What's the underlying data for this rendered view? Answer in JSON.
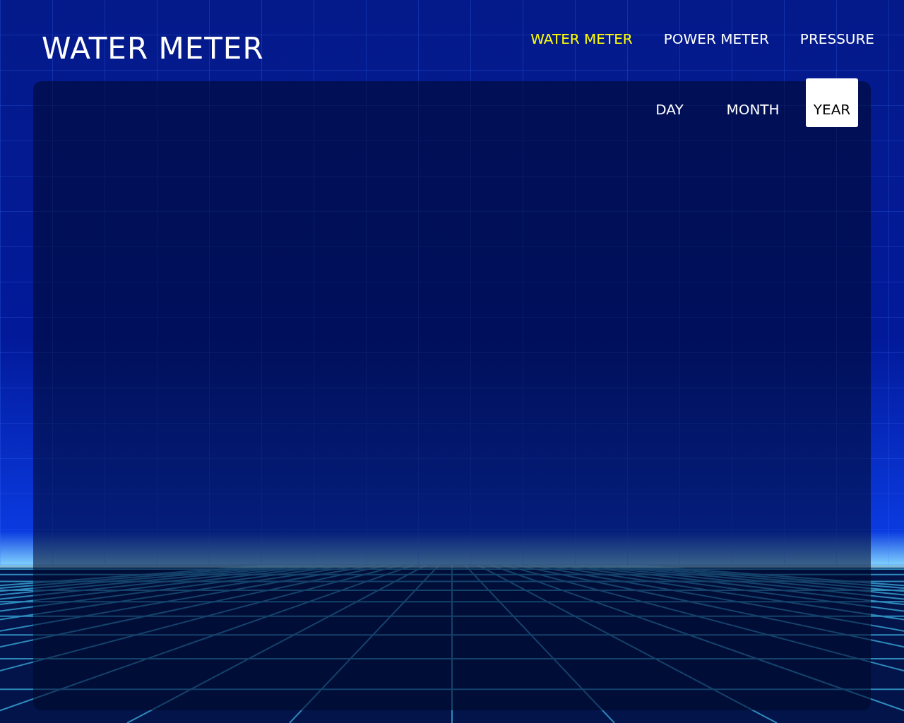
{
  "header": {
    "title": "WATER METER"
  },
  "nav": [
    {
      "label": "WATER METER",
      "selected": true
    },
    {
      "label": "POWER METER",
      "selected": false
    },
    {
      "label": "PRESSURE",
      "selected": false
    }
  ],
  "period_tabs": [
    {
      "label": "DAY",
      "selected": false
    },
    {
      "label": "MONTH",
      "selected": false
    },
    {
      "label": "YEAR",
      "selected": true
    }
  ]
}
